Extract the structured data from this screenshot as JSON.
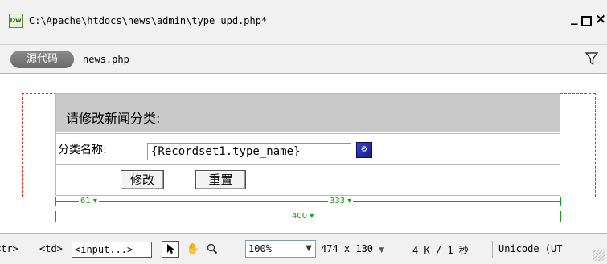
{
  "window": {
    "title": "C:\\Apache\\htdocs\\news\\admin\\type_upd.php*",
    "app_icon": "Dw",
    "minimize": "_",
    "maximize": "",
    "close": "×"
  },
  "related_files": {
    "source_code_label": "源代码",
    "file": "news.php",
    "filter_icon": "filter-icon"
  },
  "design": {
    "heading": "请修改新闻分类:",
    "field_label": "分类名称:",
    "field_value": "{Recordset1.type_name}",
    "bind_icon": "dynamic-data-icon",
    "submit_label": "修改",
    "reset_label": "重置",
    "widths": {
      "col1": "61",
      "col2": "333",
      "table": "400"
    }
  },
  "status": {
    "tag_tr": "<tr>",
    "tag_td": "<td>",
    "tag_input": "<input...>",
    "pointer_tool": "pointer-tool-icon",
    "hand_tool": "hand-tool-icon",
    "zoom_tool": "zoom-tool-icon",
    "zoom_value": "100%",
    "window_size": "474 x 130",
    "download": "4 K / 1 秒",
    "encoding": "Unicode (UT"
  },
  "colors": {
    "guide_red": "#e8302a",
    "ruler_green": "#14a014",
    "table_header_gray": "#c9c9c9"
  }
}
